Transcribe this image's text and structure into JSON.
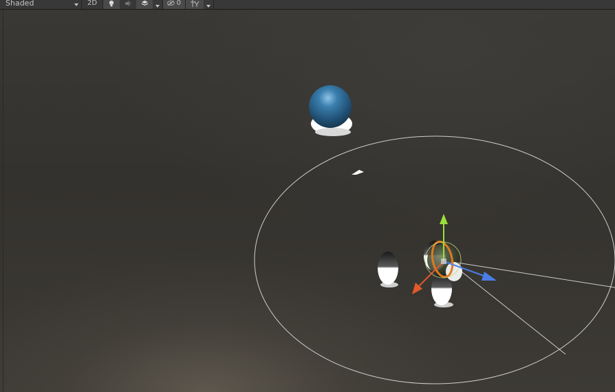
{
  "toolbar": {
    "shading_mode": "Shaded",
    "two_d_label": "2D",
    "hidden_count": "0",
    "icons": [
      "lighting-icon",
      "audio-icon",
      "effects-icon",
      "visibility-icon",
      "gizmos-icon"
    ]
  },
  "scene": {
    "objects": [
      "blue-sphere",
      "capsule-left",
      "capsule-right",
      "selected-object"
    ],
    "colors": {
      "sphere": "#2e6a93",
      "gizmo_y": "#9be03a",
      "gizmo_x": "#e05a2b",
      "gizmo_z": "#4a7ee6",
      "selection_ring": "#e07a1e",
      "light_range": "#e8e8e8"
    }
  }
}
